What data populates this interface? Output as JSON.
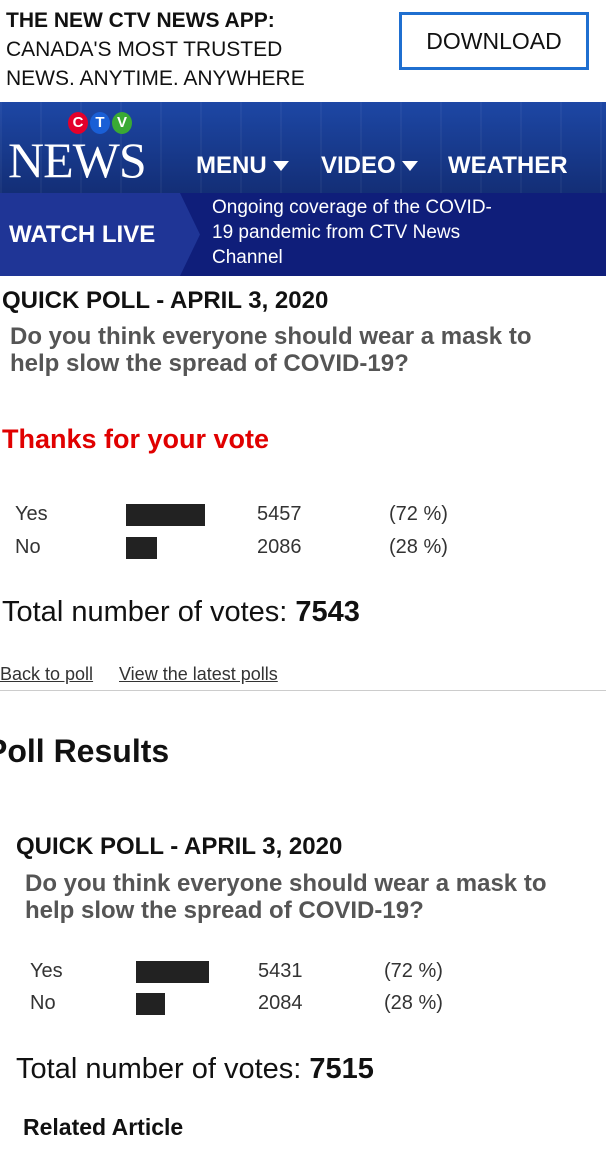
{
  "promo": {
    "line1": "THE NEW CTV NEWS APP:",
    "line2": "CANADA'S MOST TRUSTED",
    "line3": "NEWS. ANYTIME. ANYWHERE",
    "download_label": "DOWNLOAD",
    "accent_color": "#1f6fd0"
  },
  "header": {
    "ctv_letters": [
      "C",
      "T",
      "V"
    ],
    "ctv_colors": [
      "#e4002b",
      "#1a5fd6",
      "#3aa935"
    ],
    "news_logo": "NEWS",
    "nav": [
      {
        "label": "MENU",
        "icon": "caret-down-icon"
      },
      {
        "label": "VIDEO",
        "icon": "caret-down-icon"
      },
      {
        "label": "WEATHER"
      }
    ],
    "bg_color": "#1a3c8f"
  },
  "live": {
    "label": "WATCH LIVE",
    "description_line1": "Ongoing coverage of the COVID-",
    "description_line2": "19 pandemic from CTV News",
    "description_line3": "Channel"
  },
  "poll_current": {
    "date": "QUICK POLL - APRIL 3, 2020",
    "question_line1": "Do you think everyone should wear a mask to",
    "question_line2": "help slow the spread of COVID-19?",
    "thanks": "Thanks for your vote",
    "rows": [
      {
        "label": "Yes",
        "count": "5457",
        "pct": "(72 %)",
        "share": 0.72
      },
      {
        "label": "No",
        "count": "2086",
        "pct": "(28 %)",
        "share": 0.28
      }
    ],
    "total_label": "Total number of votes:",
    "total_value": "7543",
    "back_link": "Back to poll",
    "latest_link": "View the latest polls"
  },
  "results": {
    "heading": "Poll Results",
    "date": "QUICK POLL - APRIL 3, 2020",
    "question_line1": "Do you think everyone should wear a mask to",
    "question_line2": "help slow the spread of COVID-19?",
    "rows": [
      {
        "label": "Yes",
        "count": "5431",
        "pct": "(72 %)",
        "share": 0.72
      },
      {
        "label": "No",
        "count": "2084",
        "pct": "(28 %)",
        "share": 0.28
      }
    ],
    "total_label": "Total number of votes:",
    "total_value": "7515",
    "related": "Related Article"
  }
}
